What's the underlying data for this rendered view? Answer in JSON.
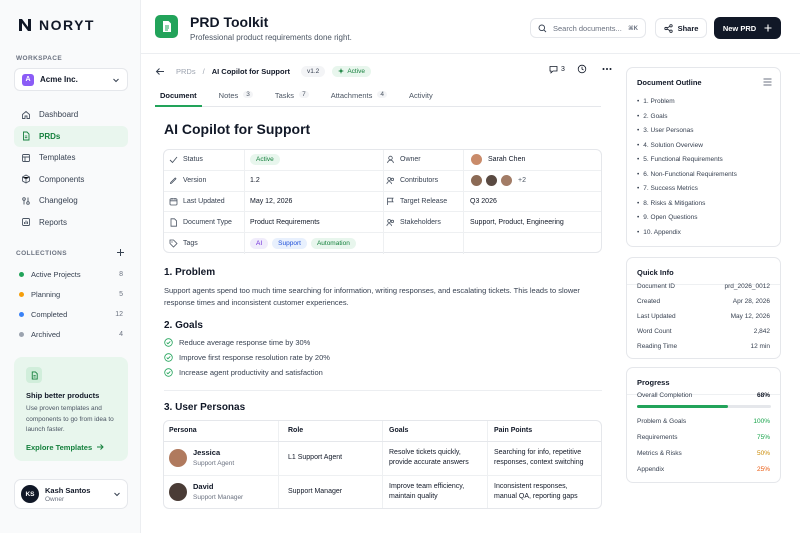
{
  "brand": {
    "name": "NORYT"
  },
  "sidebar": {
    "workspace_label": "WORKSPACE",
    "workspace": {
      "initial": "A",
      "name": "Acme Inc."
    },
    "nav": [
      {
        "label": "Dashboard",
        "icon": "home-icon"
      },
      {
        "label": "PRDs",
        "icon": "document-icon",
        "active": true
      },
      {
        "label": "Templates",
        "icon": "template-icon"
      },
      {
        "label": "Components",
        "icon": "components-icon"
      },
      {
        "label": "Changelog",
        "icon": "changelog-icon"
      },
      {
        "label": "Reports",
        "icon": "reports-icon"
      }
    ],
    "collections_label": "COLLECTIONS",
    "collections": [
      {
        "label": "Active Projects",
        "count": "8",
        "color": "#22a35a"
      },
      {
        "label": "Planning",
        "count": "5",
        "color": "#f59e0b"
      },
      {
        "label": "Completed",
        "count": "12",
        "color": "#3b82f6"
      },
      {
        "label": "Archived",
        "count": "4",
        "color": "#9ca3af"
      }
    ],
    "promo": {
      "title": "Ship better products",
      "desc": "Use proven templates and components to go from idea to launch faster.",
      "link": "Explore Templates"
    },
    "user": {
      "initials": "KS",
      "name": "Kash Santos",
      "role": "Owner"
    }
  },
  "header": {
    "title": "PRD Toolkit",
    "subtitle": "Professional product requirements done right.",
    "search_placeholder": "Search documents...",
    "search_shortcut": "⌘K",
    "share_label": "Share",
    "new_label": "New PRD"
  },
  "breadcrumb": {
    "parent": "PRDs",
    "separator": "/",
    "current": "AI Copilot for Support",
    "version": "v1.2",
    "status": "Active",
    "comments": "3"
  },
  "tabs": [
    {
      "label": "Document",
      "count": ""
    },
    {
      "label": "Notes",
      "count": "3"
    },
    {
      "label": "Tasks",
      "count": "7"
    },
    {
      "label": "Attachments",
      "count": "4"
    },
    {
      "label": "Activity",
      "count": ""
    }
  ],
  "doc": {
    "title": "AI Copilot for Support",
    "props": {
      "status_label": "Status",
      "status": "Active",
      "owner_label": "Owner",
      "owner": "Sarah Chen",
      "version_label": "Version",
      "version": "1.2",
      "contributors_label": "Contributors",
      "contributors_more": "+2",
      "updated_label": "Last Updated",
      "updated": "May 12, 2026",
      "target_label": "Target Release",
      "target": "Q3 2026",
      "type_label": "Document Type",
      "type": "Product Requirements",
      "stakeholders_label": "Stakeholders",
      "stakeholders": "Support, Product, Engineering",
      "tags_label": "Tags",
      "tags": [
        "AI",
        "Support",
        "Automation"
      ]
    },
    "problem_heading": "1. Problem",
    "problem_text": "Support agents spend too much time searching for information, writing responses, and escalating tickets. This leads to slower response times and inconsistent customer experiences.",
    "goals_heading": "2. Goals",
    "goals": [
      "Reduce average response time by 30%",
      "Improve first response resolution rate by 20%",
      "Increase agent productivity and satisfaction"
    ],
    "personas_heading": "3. User Personas",
    "persona_columns": [
      "Persona",
      "Role",
      "Goals",
      "Pain Points"
    ],
    "personas": [
      {
        "name": "Jessica",
        "subtitle": "Support Agent",
        "role": "L1 Support Agent",
        "goals_1": "Resolve tickets quickly,",
        "goals_2": "provide accurate answers",
        "pain_1": "Searching for info, repetitive",
        "pain_2": "responses, context switching"
      },
      {
        "name": "David",
        "subtitle": "Support Manager",
        "role": "Support Manager",
        "goals_1": "Improve team efficiency,",
        "goals_2": "maintain quality",
        "pain_1": "Inconsistent responses,",
        "pain_2": "manual QA, reporting gaps"
      }
    ]
  },
  "outline": {
    "title": "Document Outline",
    "items": [
      "1.  Problem",
      "2.  Goals",
      "3.  User Personas",
      "4.  Solution Overview",
      "5.  Functional Requirements",
      "6.  Non-Functional Requirements",
      "7.  Success Metrics",
      "8.  Risks & Mitigations",
      "9.  Open Questions",
      "10.  Appendix"
    ]
  },
  "quick_info": {
    "title": "Quick Info",
    "rows": [
      {
        "label": "Document ID",
        "value": "prd_2026_0012"
      },
      {
        "label": "Created",
        "value": "Apr 28, 2026"
      },
      {
        "label": "Last Updated",
        "value": "May 12, 2026"
      },
      {
        "label": "Word Count",
        "value": "2,842"
      },
      {
        "label": "Reading Time",
        "value": "12 min"
      }
    ]
  },
  "progress": {
    "title": "Progress",
    "overall_label": "Overall Completion",
    "overall_value": "68%",
    "overall_fraction": 0.68,
    "rows": [
      {
        "label": "Problem & Goals",
        "value": "100%",
        "color": "#16a34a"
      },
      {
        "label": "Requirements",
        "value": "75%",
        "color": "#16a34a"
      },
      {
        "label": "Metrics & Risks",
        "value": "50%",
        "color": "#ca8a04"
      },
      {
        "label": "Appendix",
        "value": "25%",
        "color": "#ea580c"
      }
    ]
  },
  "colors": {
    "accent": "#22a35a",
    "dark": "#111827"
  }
}
